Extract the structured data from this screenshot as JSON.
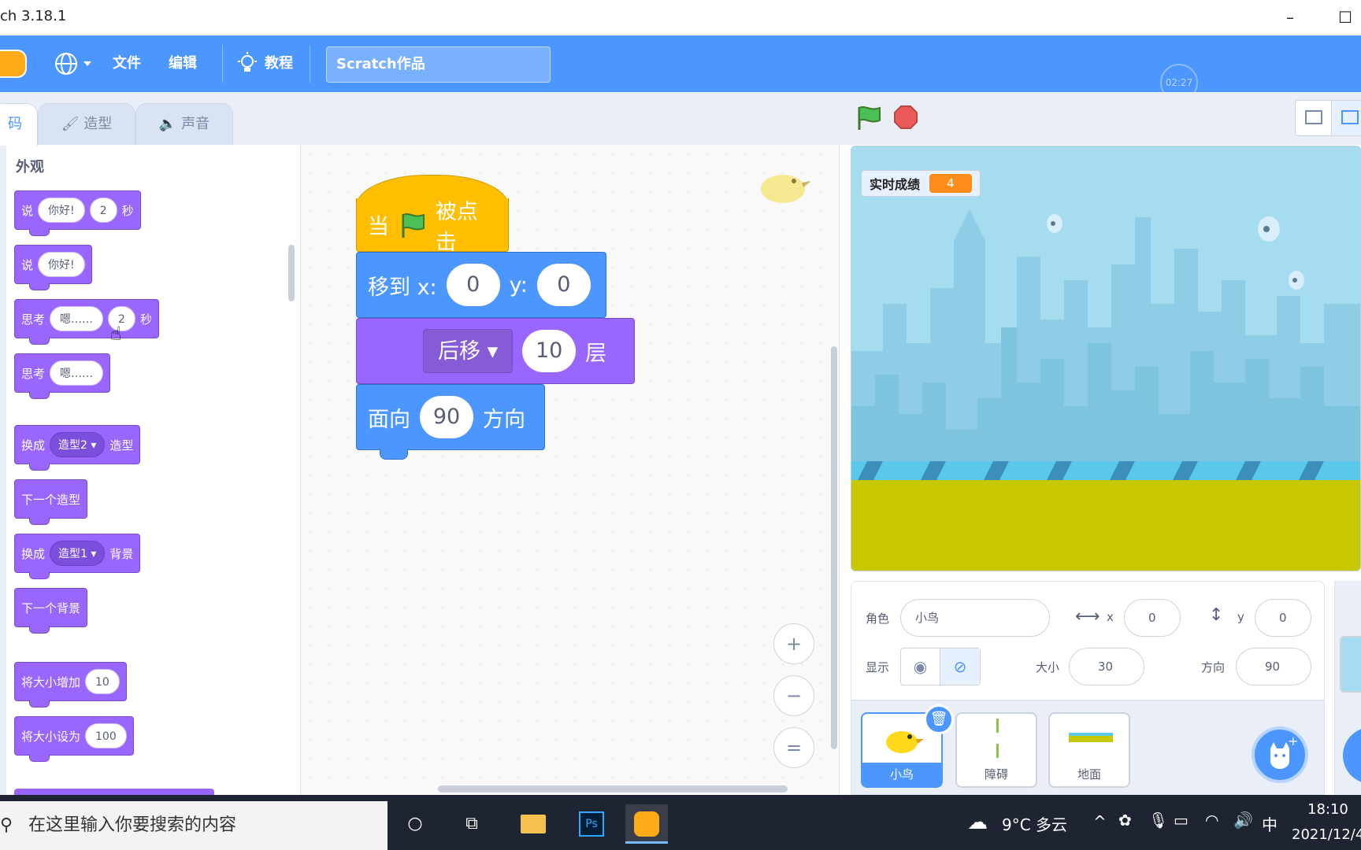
{
  "window": {
    "title": "ch 3.18.1",
    "minimize": "–",
    "maximize": "☐"
  },
  "menubar": {
    "file": "文件",
    "edit": "编辑",
    "tutorials": "教程",
    "project_title": "Scratch作品",
    "timer": "02:27"
  },
  "tabs": {
    "code": "码",
    "costumes": "造型",
    "sounds": "声音"
  },
  "palette": {
    "category": "外观",
    "blocks": [
      {
        "id": "say-for-secs",
        "parts": [
          "说",
          "你好!",
          "2",
          "秒"
        ]
      },
      {
        "id": "say",
        "parts": [
          "说",
          "你好!"
        ]
      },
      {
        "id": "think-for-secs",
        "parts": [
          "思考",
          "嗯……",
          "2",
          "秒"
        ]
      },
      {
        "id": "think",
        "parts": [
          "思考",
          "嗯……"
        ]
      },
      {
        "id": "switch-costume",
        "parts": [
          "换成",
          "造型2",
          "造型"
        ]
      },
      {
        "id": "next-costume",
        "parts": [
          "下一个造型"
        ]
      },
      {
        "id": "switch-backdrop",
        "parts": [
          "换成",
          "造型1",
          "背景"
        ]
      },
      {
        "id": "next-backdrop",
        "parts": [
          "下一个背景"
        ]
      },
      {
        "id": "change-size",
        "parts": [
          "将大小增加",
          "10"
        ]
      },
      {
        "id": "set-size",
        "parts": [
          "将大小设为",
          "100"
        ]
      }
    ]
  },
  "script": {
    "hat": {
      "when": "当",
      "clicked": "被点击"
    },
    "goto": {
      "label": "移到 x:",
      "x": "0",
      "ylabel": "y:",
      "y": "0"
    },
    "layer": {
      "dir": "后移",
      "n": "10",
      "unit": "层"
    },
    "point": {
      "label": "面向",
      "deg": "90",
      "unit": "方向"
    }
  },
  "zoom": {
    "in": "+",
    "out": "−",
    "reset": "="
  },
  "stage": {
    "monitor_label": "实时成绩",
    "monitor_value": "4"
  },
  "sprite_info": {
    "sprite_label": "角色",
    "sprite_name": "小鸟",
    "x_label": "x",
    "x": "0",
    "y_label": "y",
    "y": "0",
    "show_label": "显示",
    "size_label": "大小",
    "size": "30",
    "direction_label": "方向",
    "direction": "90"
  },
  "sprites": [
    {
      "name": "小鸟"
    },
    {
      "name": "障碍"
    },
    {
      "name": "地面"
    }
  ],
  "taskbar": {
    "search_placeholder": "在这里输入你要搜索的内容",
    "weather": "9°C 多云",
    "ime": "中",
    "time": "18:10",
    "date": "2021/12/4"
  },
  "colors": {
    "accent": "#4c97ff",
    "looks": "#9966ff",
    "events": "#ffbf00",
    "motion": "#4c97ff",
    "monitor": "#ff8c1a"
  }
}
